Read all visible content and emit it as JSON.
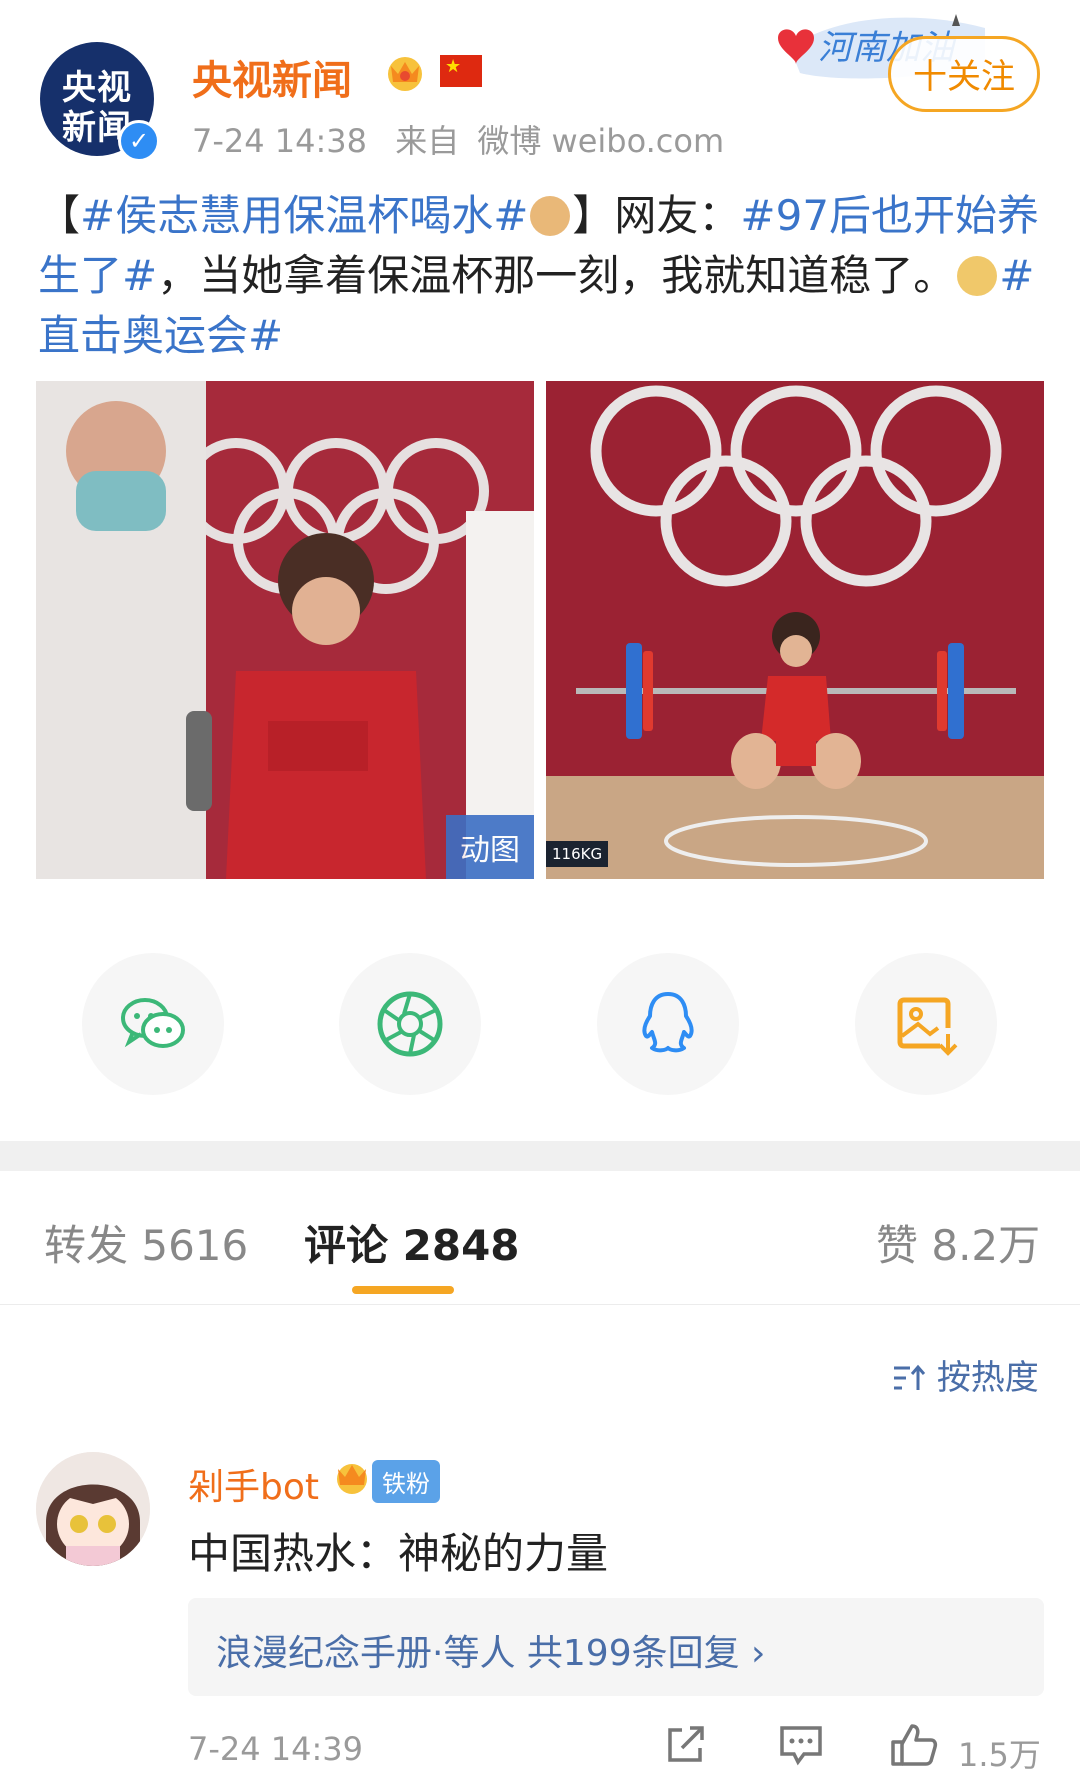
{
  "header": {
    "avatar_line1": "央视",
    "avatar_line2": "新闻",
    "username": "央视新闻",
    "post_time": "7-24 14:38",
    "source_prefix": "来自",
    "source": "微博 weibo.com",
    "follow_label": "十关注",
    "promo_text": "河南加油"
  },
  "post": {
    "bracket_open": "【",
    "tag1": "#侯志慧用保温杯喝水#",
    "bracket_close": "】网友：",
    "tag2": "#97后也开始养生了#",
    "text_mid": "，当她拿着保温杯那一刻，我就知道稳了。",
    "tag3": "#直击奥运会#",
    "image1_badge": "动图",
    "image2_badge": "116KG"
  },
  "share": {
    "icons": [
      "wechat-icon",
      "moments-icon",
      "qq-icon",
      "save-image-icon"
    ]
  },
  "tabs": {
    "repost": "转发 5616",
    "comments": "评论 2848",
    "likes": "赞 8.2万"
  },
  "sort_label": "按热度",
  "comment": {
    "username": "剁手bot",
    "fan_label": "铁粉",
    "text": "中国热水：神秘的力量",
    "reply_summary": "浪漫纪念手册·等人  共199条回复 ›",
    "time": "7-24 14:39",
    "like_count": "1.5万"
  },
  "colors": {
    "accent_orange": "#f5a623",
    "link_blue": "#3a74c9",
    "username_orange": "#f06e1a",
    "wechat_green": "#3cb878",
    "qq_blue": "#2e8df4"
  }
}
